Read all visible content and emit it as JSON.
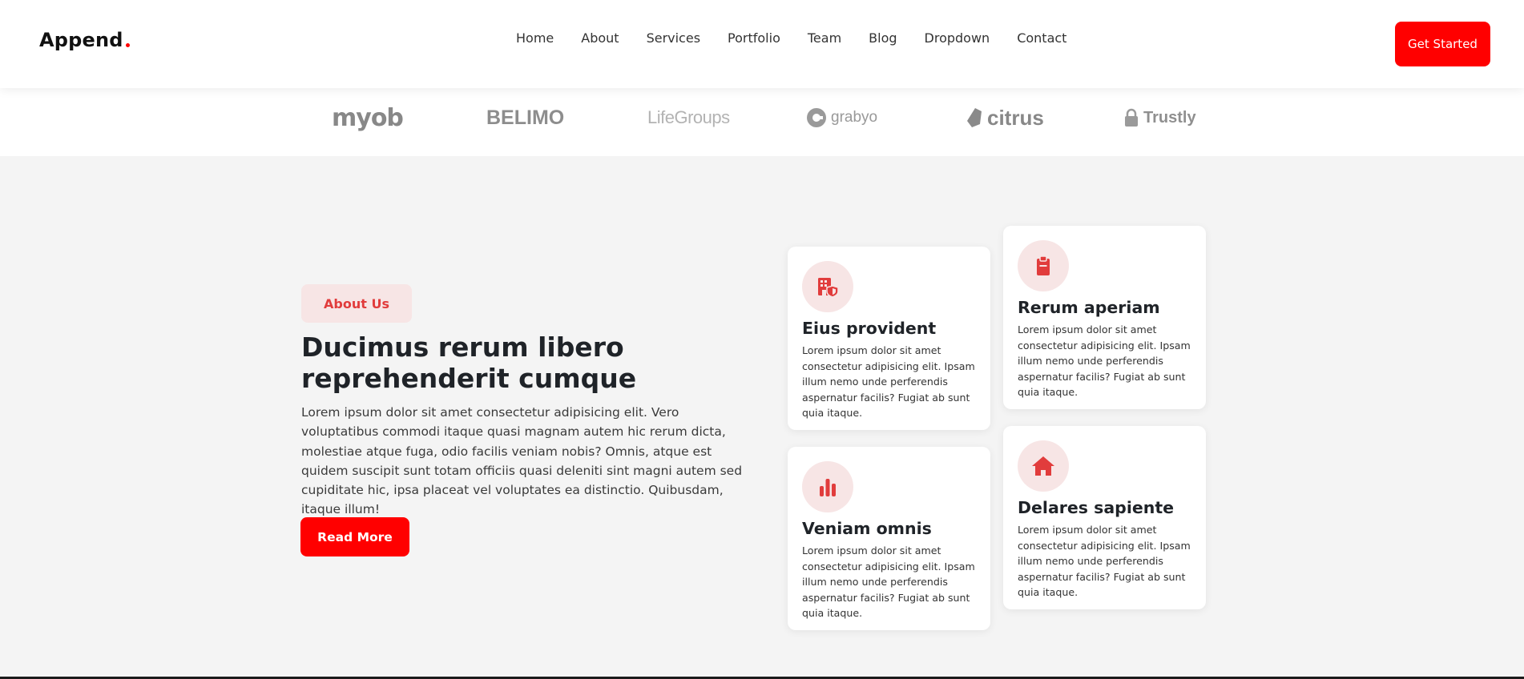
{
  "brand": {
    "name": "Append",
    "accent": "#ff0000"
  },
  "nav": {
    "items": [
      {
        "label": "Home"
      },
      {
        "label": "About"
      },
      {
        "label": "Services"
      },
      {
        "label": "Portfolio"
      },
      {
        "label": "Team"
      },
      {
        "label": "Blog"
      },
      {
        "label": "Dropdown"
      },
      {
        "label": "Contact"
      }
    ],
    "cta_label": "Get Started"
  },
  "clients": {
    "logos": [
      {
        "text": "myob"
      },
      {
        "text": "BELIMO"
      },
      {
        "text": "LifeGroups"
      },
      {
        "text": "grabyo"
      },
      {
        "text": "citrus"
      },
      {
        "text": "Trustly"
      }
    ]
  },
  "about": {
    "badge": "About Us",
    "title": "Ducimus rerum libero reprehenderit cumque",
    "text": "Lorem ipsum dolor sit amet consectetur adipisicing elit. Vero voluptatibus commodi itaque quasi magnam autem hic rerum dicta, molestiae atque fuga, odio facilis veniam nobis? Omnis, atque est quidem suscipit sunt totam officiis quasi deleniti sint magni autem sed cupiditate hic, ipsa placeat vel voluptates ea distinctio. Quibusdam, itaque illum!",
    "button_label": "Read More"
  },
  "features": [
    {
      "icon": "building-shield-icon",
      "title": "Eius provident",
      "text": "Lorem ipsum dolor sit amet consectetur adipisicing elit. Ipsam illum nemo unde perferendis aspernatur facilis? Fugiat ab sunt quia itaque."
    },
    {
      "icon": "clipboard-icon",
      "title": "Rerum aperiam",
      "text": "Lorem ipsum dolor sit amet consectetur adipisicing elit. Ipsam illum nemo unde perferendis aspernatur facilis? Fugiat ab sunt quia itaque."
    },
    {
      "icon": "bar-chart-icon",
      "title": "Veniam omnis",
      "text": "Lorem ipsum dolor sit amet consectetur adipisicing elit. Ipsam illum nemo unde perferendis aspernatur facilis? Fugiat ab sunt quia itaque."
    },
    {
      "icon": "house-icon",
      "title": "Delares sapiente",
      "text": "Lorem ipsum dolor sit amet consectetur adipisicing elit. Ipsam illum nemo unde perferendis aspernatur facilis? Fugiat ab sunt quia itaque."
    }
  ],
  "colors": {
    "accent": "#ff0000",
    "icon_red": "#e13c3c",
    "badge_bg": "#f7e5e5",
    "section_bg": "#f4f4f4"
  }
}
